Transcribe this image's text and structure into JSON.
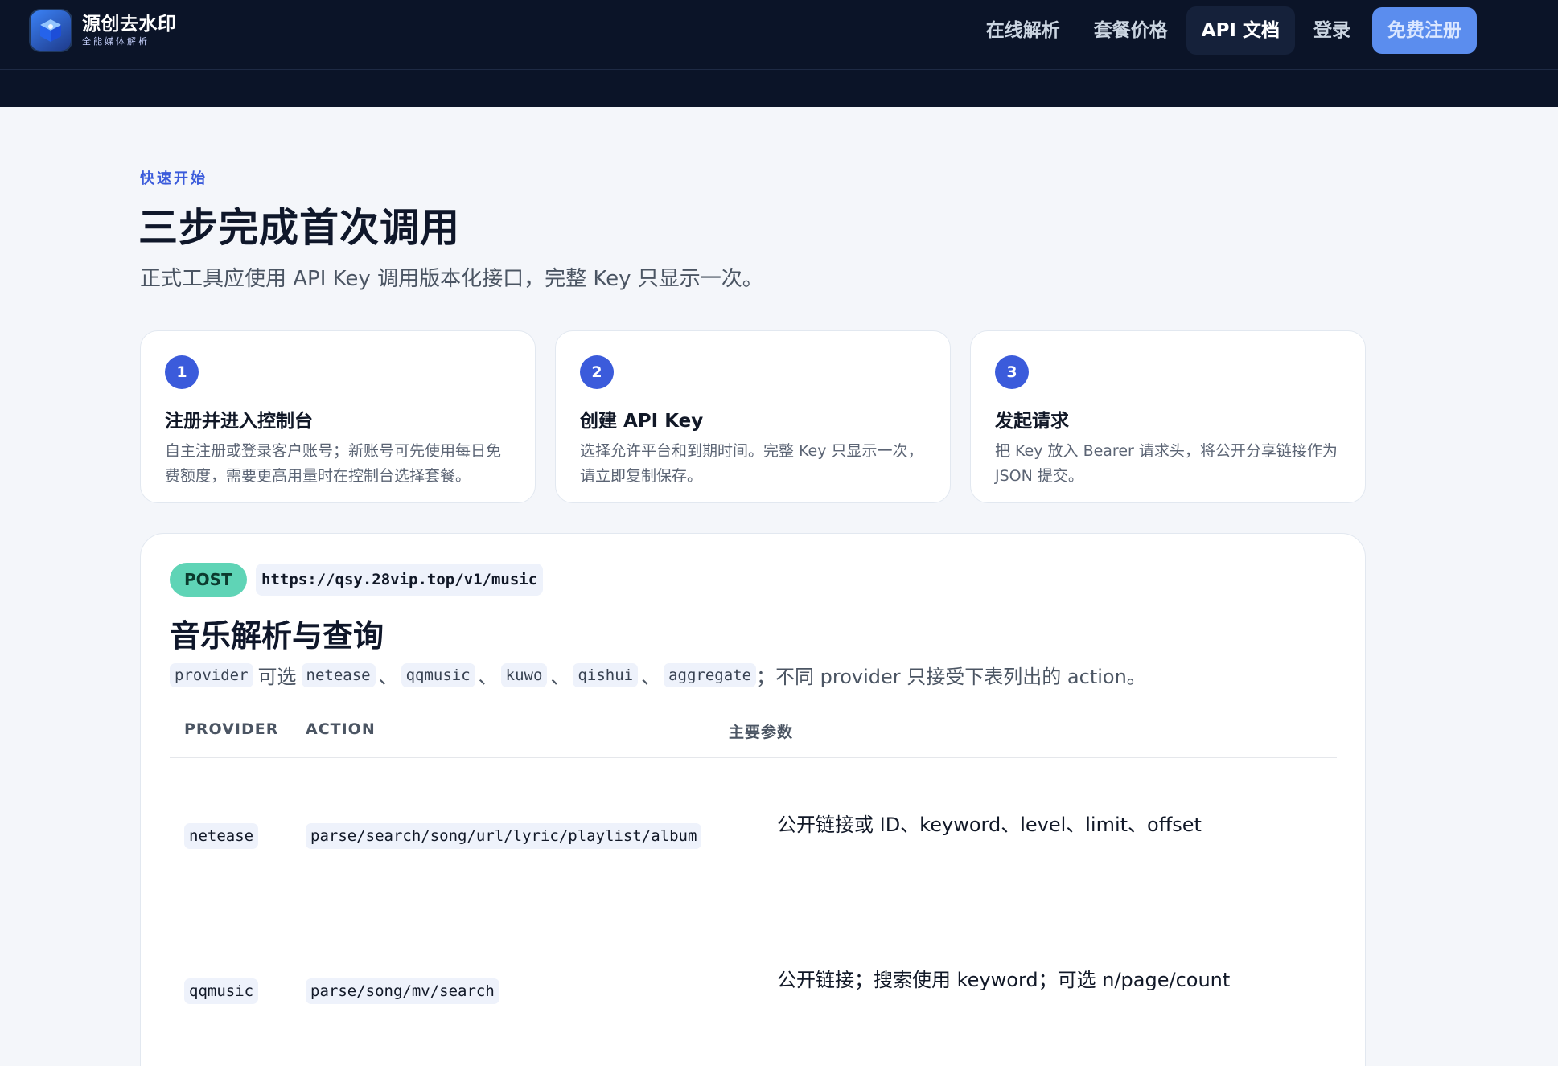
{
  "header": {
    "brand_name": "源创去水印",
    "brand_sub": "全能媒体解析",
    "nav": [
      {
        "label": "在线解析"
      },
      {
        "label": "套餐价格"
      },
      {
        "label": "API 文档"
      },
      {
        "label": "登录"
      }
    ],
    "cta_label": "免费注册"
  },
  "intro": {
    "eyebrow": "快速开始",
    "title": "三步完成首次调用",
    "lead": "正式工具应使用 API Key 调用版本化接口，完整 Key 只显示一次。"
  },
  "steps": [
    {
      "num": "1",
      "title": "注册并进入控制台",
      "desc": "自主注册或登录客户账号；新账号可先使用每日免费额度，需要更高用量时在控制台选择套餐。"
    },
    {
      "num": "2",
      "title": "创建 API Key",
      "desc": "选择允许平台和到期时间。完整 Key 只显示一次，请立即复制保存。"
    },
    {
      "num": "3",
      "title": "发起请求",
      "desc": "把 Key 放入 Bearer 请求头，将公开分享链接作为 JSON 提交。"
    }
  ],
  "api": {
    "method": "POST",
    "endpoint": "https://qsy.28vip.top/v1/music",
    "title": "音乐解析与查询",
    "desc": {
      "param": "provider",
      "optional_text": "可选",
      "providers": [
        "netease",
        "qqmusic",
        "kuwo",
        "qishui",
        "aggregate"
      ],
      "comma": "、",
      "suffix": "；不同 provider 只接受下表列出的 action。"
    },
    "table": {
      "headers": [
        "PROVIDER",
        "ACTION",
        "主要参数"
      ],
      "rows": [
        {
          "provider": "netease",
          "action": "parse/search/song/url/lyric/playlist/album",
          "params": "公开链接或 ID、keyword、level、limit、offset"
        },
        {
          "provider": "qqmusic",
          "action": "parse/song/mv/search",
          "params": "公开链接；搜索使用 keyword；可选 n/page/count"
        }
      ]
    }
  }
}
